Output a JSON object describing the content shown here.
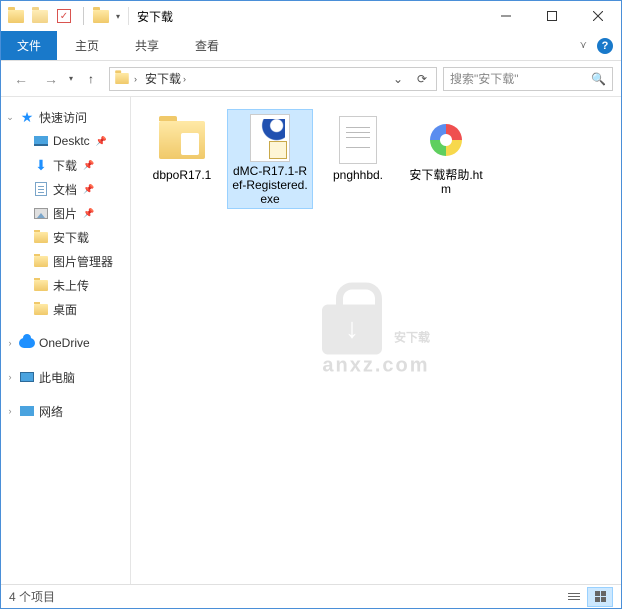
{
  "window": {
    "title": "安下载"
  },
  "ribbon": {
    "file": "文件",
    "tabs": [
      "主页",
      "共享",
      "查看"
    ]
  },
  "nav": {
    "breadcrumb_root": "安下载",
    "search_placeholder": "搜索\"安下载\""
  },
  "tree": {
    "quick_access": "快速访问",
    "items": [
      {
        "label": "Desktc",
        "icon": "desktop",
        "pinned": true
      },
      {
        "label": "下载",
        "icon": "download",
        "pinned": true
      },
      {
        "label": "文档",
        "icon": "doc",
        "pinned": true
      },
      {
        "label": "图片",
        "icon": "pic",
        "pinned": true
      },
      {
        "label": "安下载",
        "icon": "folder",
        "pinned": false
      },
      {
        "label": "图片管理器",
        "icon": "folder",
        "pinned": false
      },
      {
        "label": "未上传",
        "icon": "folder",
        "pinned": false
      },
      {
        "label": "桌面",
        "icon": "folder",
        "pinned": false
      }
    ],
    "onedrive": "OneDrive",
    "this_pc": "此电脑",
    "network": "网络"
  },
  "files": [
    {
      "name": "dbpoR17.1",
      "type": "folder-apple",
      "selected": false
    },
    {
      "name": "dMC-R17.1-Ref-Registered.exe",
      "type": "exe",
      "selected": true
    },
    {
      "name": "pnghhbd.",
      "type": "txt",
      "selected": false
    },
    {
      "name": "安下载帮助.htm",
      "type": "htm",
      "selected": false
    }
  ],
  "status": {
    "count_label": "4 个项目"
  },
  "watermark": {
    "main": "安下载",
    "sub": "anxz.com"
  }
}
